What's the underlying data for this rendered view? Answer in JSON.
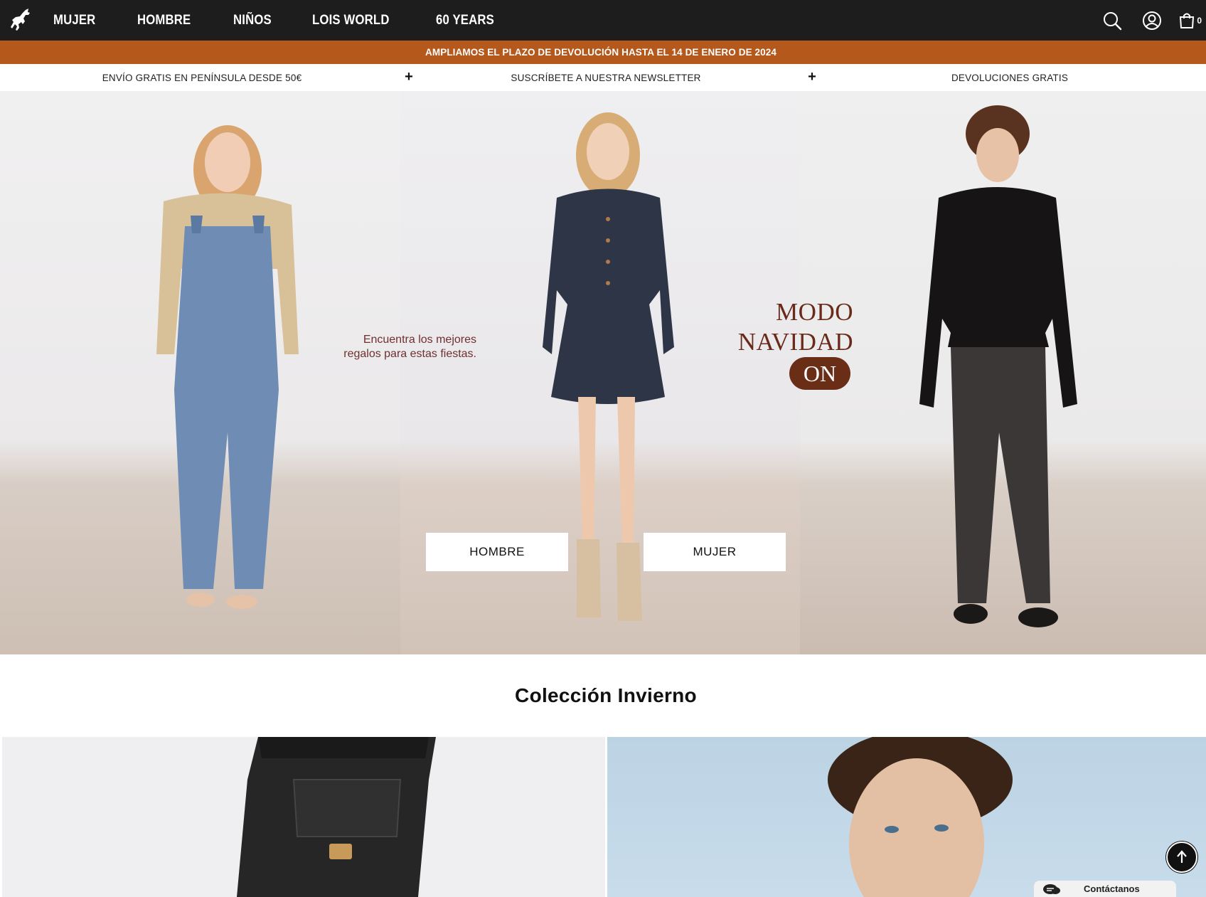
{
  "nav": {
    "logo": "lois-bull-logo",
    "links": [
      "MUJER",
      "HOMBRE",
      "NIÑOS",
      "LOIS WORLD",
      "60 YEARS"
    ],
    "icons": [
      "search-icon",
      "user-icon",
      "bag-icon"
    ],
    "cart_count": "0"
  },
  "promo_banner": {
    "text": "AMPLIAMOS EL PLAZO DE DEVOLUCIÓN HASTA EL 14 DE ENERO DE 2024",
    "color": "#b5581b"
  },
  "info_strip": {
    "items": [
      "ENVÍO GRATIS EN PENÍNSULA DESDE 50€",
      "SUSCRÍBETE A NUESTRA NEWSLETTER",
      "DEVOLUCIONES GRATIS"
    ],
    "separator": "+"
  },
  "hero": {
    "tagline_line1": "Encuentra los mejores",
    "tagline_line2": "regalos para estas fiestas.",
    "headline_line1": "MODO",
    "headline_line2": "NAVIDAD",
    "badge": "ON",
    "buttons": [
      "HOMBRE",
      "MUJER"
    ],
    "accent_color": "#6a2d16"
  },
  "collection": {
    "title": "Colección Invierno"
  },
  "widgets": {
    "scroll_top_icon": "arrow-up-icon",
    "contact_label": "Contáctanos",
    "contact_icon": "chat-icon"
  }
}
